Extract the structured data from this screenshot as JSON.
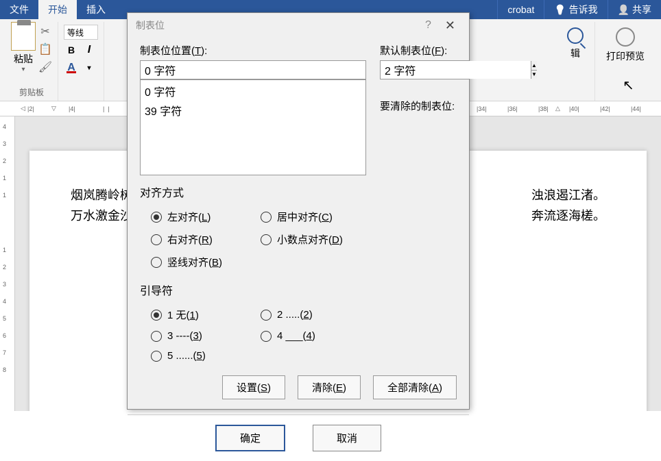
{
  "ribbon": {
    "tabs": {
      "file": "文件",
      "home": "开始",
      "insert": "插入"
    },
    "right": {
      "acrobat": "crobat",
      "tellme": "告诉我",
      "share": "共享"
    },
    "clipboard": {
      "paste": "粘贴",
      "group": "剪贴板"
    },
    "font": {
      "name": "等线"
    },
    "edit": {
      "label": "辑"
    },
    "preview": {
      "label": "打印预览"
    }
  },
  "ruler": {
    "h": [
      "2",
      "4",
      "34",
      "36",
      "38",
      "40",
      "42",
      "44"
    ],
    "v": [
      "4",
      "3",
      "2",
      "1",
      "1",
      "1",
      "2",
      "3",
      "4",
      "5",
      "6",
      "7",
      "8"
    ]
  },
  "doc": {
    "line1a": "烟岚腾岭树,",
    "line1b": "浊浪遏江渚。",
    "line2a": "万水激金沙,",
    "line2b": "奔流逐海槎。"
  },
  "dialog": {
    "title": "制表位",
    "pos_label_pre": "制表位位置(",
    "pos_label_u": "T",
    "pos_label_post": "):",
    "pos_value": "0 字符",
    "list": [
      "0 字符",
      "39 字符"
    ],
    "default_label_pre": "默认制表位(",
    "default_label_u": "F",
    "default_label_post": "):",
    "default_value": "2 字符",
    "clear_label": "要清除的制表位:",
    "align_section": "对齐方式",
    "align": {
      "left_pre": "左对齐(",
      "left_u": "L",
      "left_post": ")",
      "center_pre": "居中对齐(",
      "center_u": "C",
      "center_post": ")",
      "right_pre": "右对齐(",
      "right_u": "R",
      "right_post": ")",
      "decimal_pre": "小数点对齐(",
      "decimal_u": "D",
      "decimal_post": ")",
      "bar_pre": "竖线对齐(",
      "bar_u": "B",
      "bar_post": ")"
    },
    "leader_section": "引导符",
    "leader": {
      "l1_pre": "1 无(",
      "l1_u": "1",
      "l1_post": ")",
      "l2_pre": "2 .....(",
      "l2_u": "2",
      "l2_post": ")",
      "l3_pre": "3 ----(",
      "l3_u": "3",
      "l3_post": ")",
      "l4_pre": "4 ___(",
      "l4_u": "4",
      "l4_post": ")",
      "l5_pre": "5 ......(",
      "l5_u": "5",
      "l5_post": ")"
    },
    "btn_set_pre": "设置(",
    "btn_set_u": "S",
    "btn_set_post": ")",
    "btn_clear_pre": "清除(",
    "btn_clear_u": "E",
    "btn_clear_post": ")",
    "btn_clearall_pre": "全部清除(",
    "btn_clearall_u": "A",
    "btn_clearall_post": ")",
    "ok": "确定",
    "cancel": "取消"
  }
}
